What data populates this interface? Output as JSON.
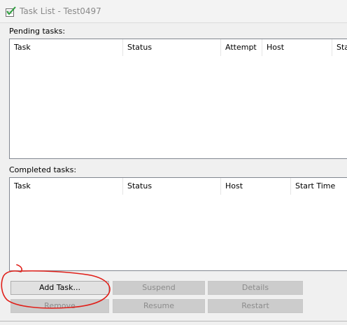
{
  "window": {
    "title": "Task List - Test0497"
  },
  "pending": {
    "label": "Pending tasks:",
    "columns": [
      "Task",
      "Status",
      "Attempt",
      "Host",
      "Sta"
    ]
  },
  "completed": {
    "label": "Completed tasks:",
    "columns": [
      "Task",
      "Status",
      "Host",
      "Start Time"
    ]
  },
  "buttons": {
    "add_task": "Add Task...",
    "suspend": "Suspend",
    "details": "Details",
    "remove": "Remove",
    "resume": "Resume",
    "restart": "Restart"
  },
  "colors": {
    "annotation": "#e0201a",
    "icon_check": "#2e9e3e"
  },
  "icons": {
    "title": "checklist-icon"
  }
}
